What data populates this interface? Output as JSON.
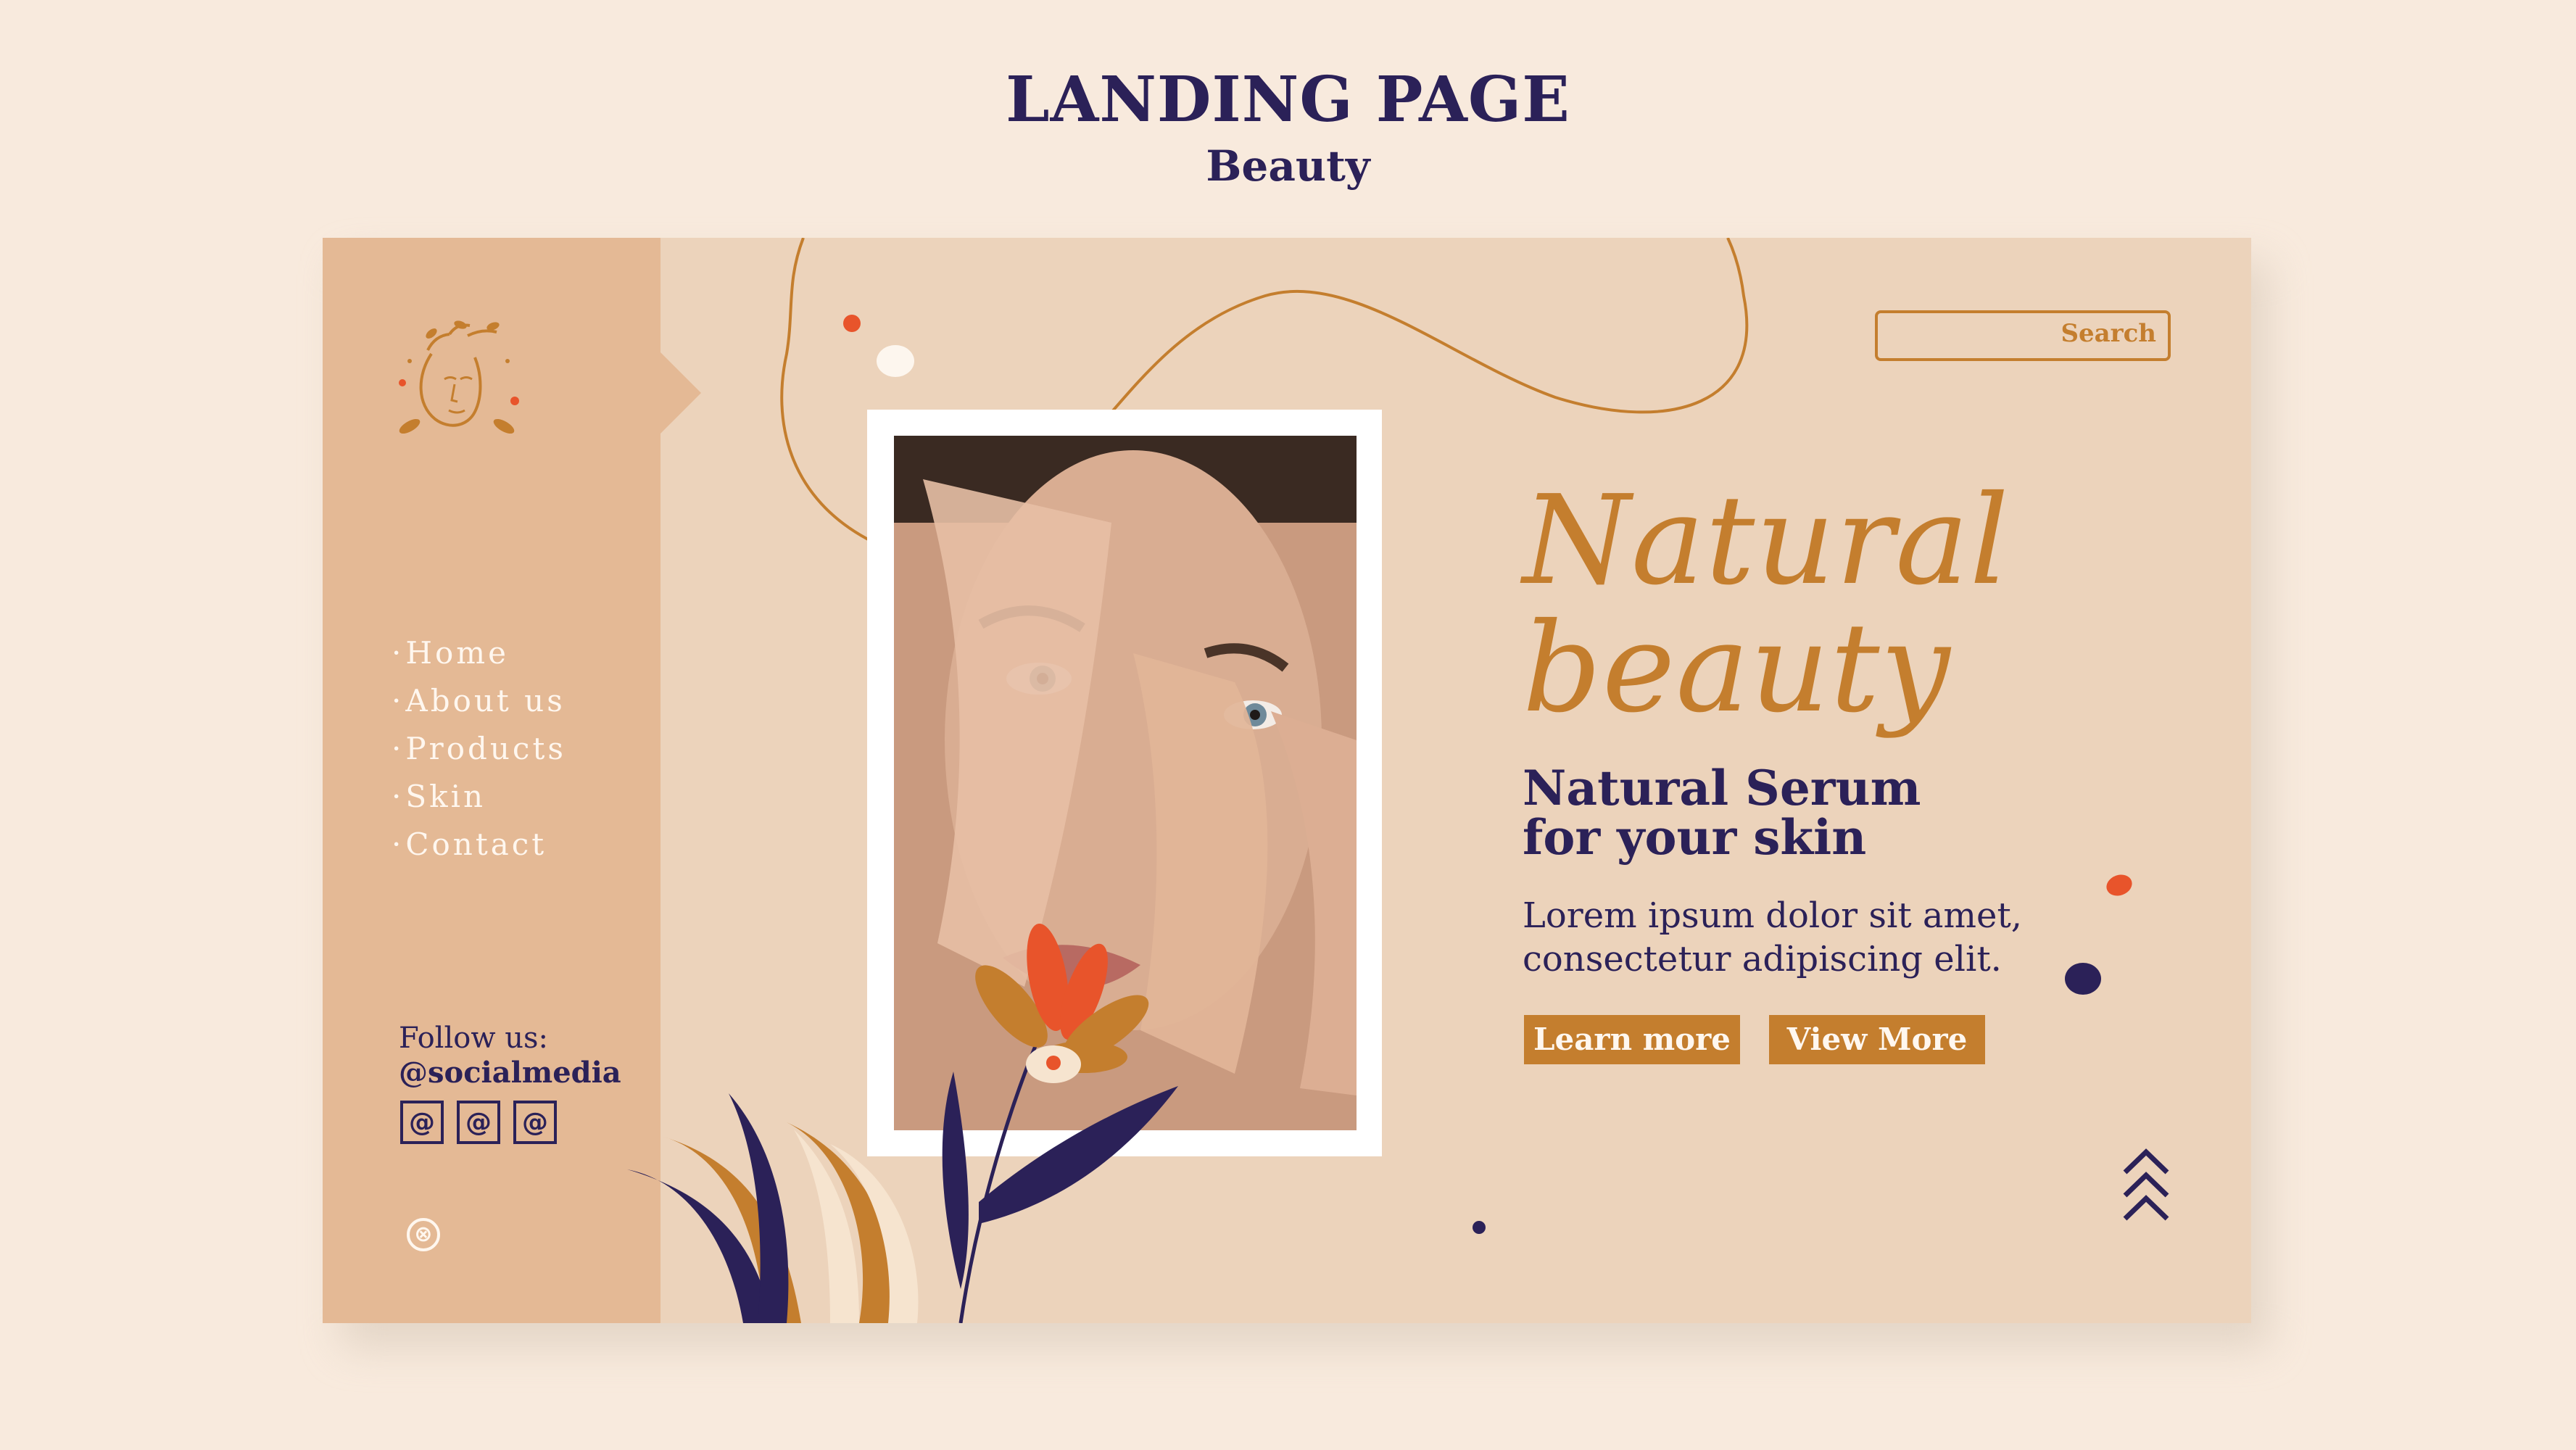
{
  "header": {
    "title": "LANDING PAGE",
    "subtitle": "Beauty"
  },
  "colors": {
    "background": "#f8eadd",
    "panel": "#ecd3bb",
    "sidebar": "#e4b995",
    "accent": "#c47e2e",
    "navy": "#2b2158",
    "coral": "#e8542b"
  },
  "sidebar": {
    "logo_icon": "face-with-leaves-icon",
    "nav": [
      {
        "dot": "·",
        "label": "Home"
      },
      {
        "dot": "·",
        "label": "About us"
      },
      {
        "dot": "·",
        "label": "Products"
      },
      {
        "dot": "·",
        "label": "Skin"
      },
      {
        "dot": "·",
        "label": "Contact"
      }
    ],
    "follow_label": "Follow us:",
    "follow_handle": "@socialmedia",
    "social_icons": [
      "@",
      "@",
      "@"
    ],
    "close_glyph": "⊗"
  },
  "search": {
    "label": "Search",
    "value": ""
  },
  "hero": {
    "title_line1": "Natural",
    "title_line2": "beauty",
    "subtitle_line1": "Natural Serum",
    "subtitle_line2": "for your skin",
    "body_line1": "Lorem ipsum dolor sit amet,",
    "body_line2": "consectetur adipiscing elit.",
    "primary_button": "Learn more",
    "secondary_button": "View More"
  },
  "icons": {
    "scroll_up": "triple-chevron-up-icon",
    "photo": "woman-face-photo"
  }
}
